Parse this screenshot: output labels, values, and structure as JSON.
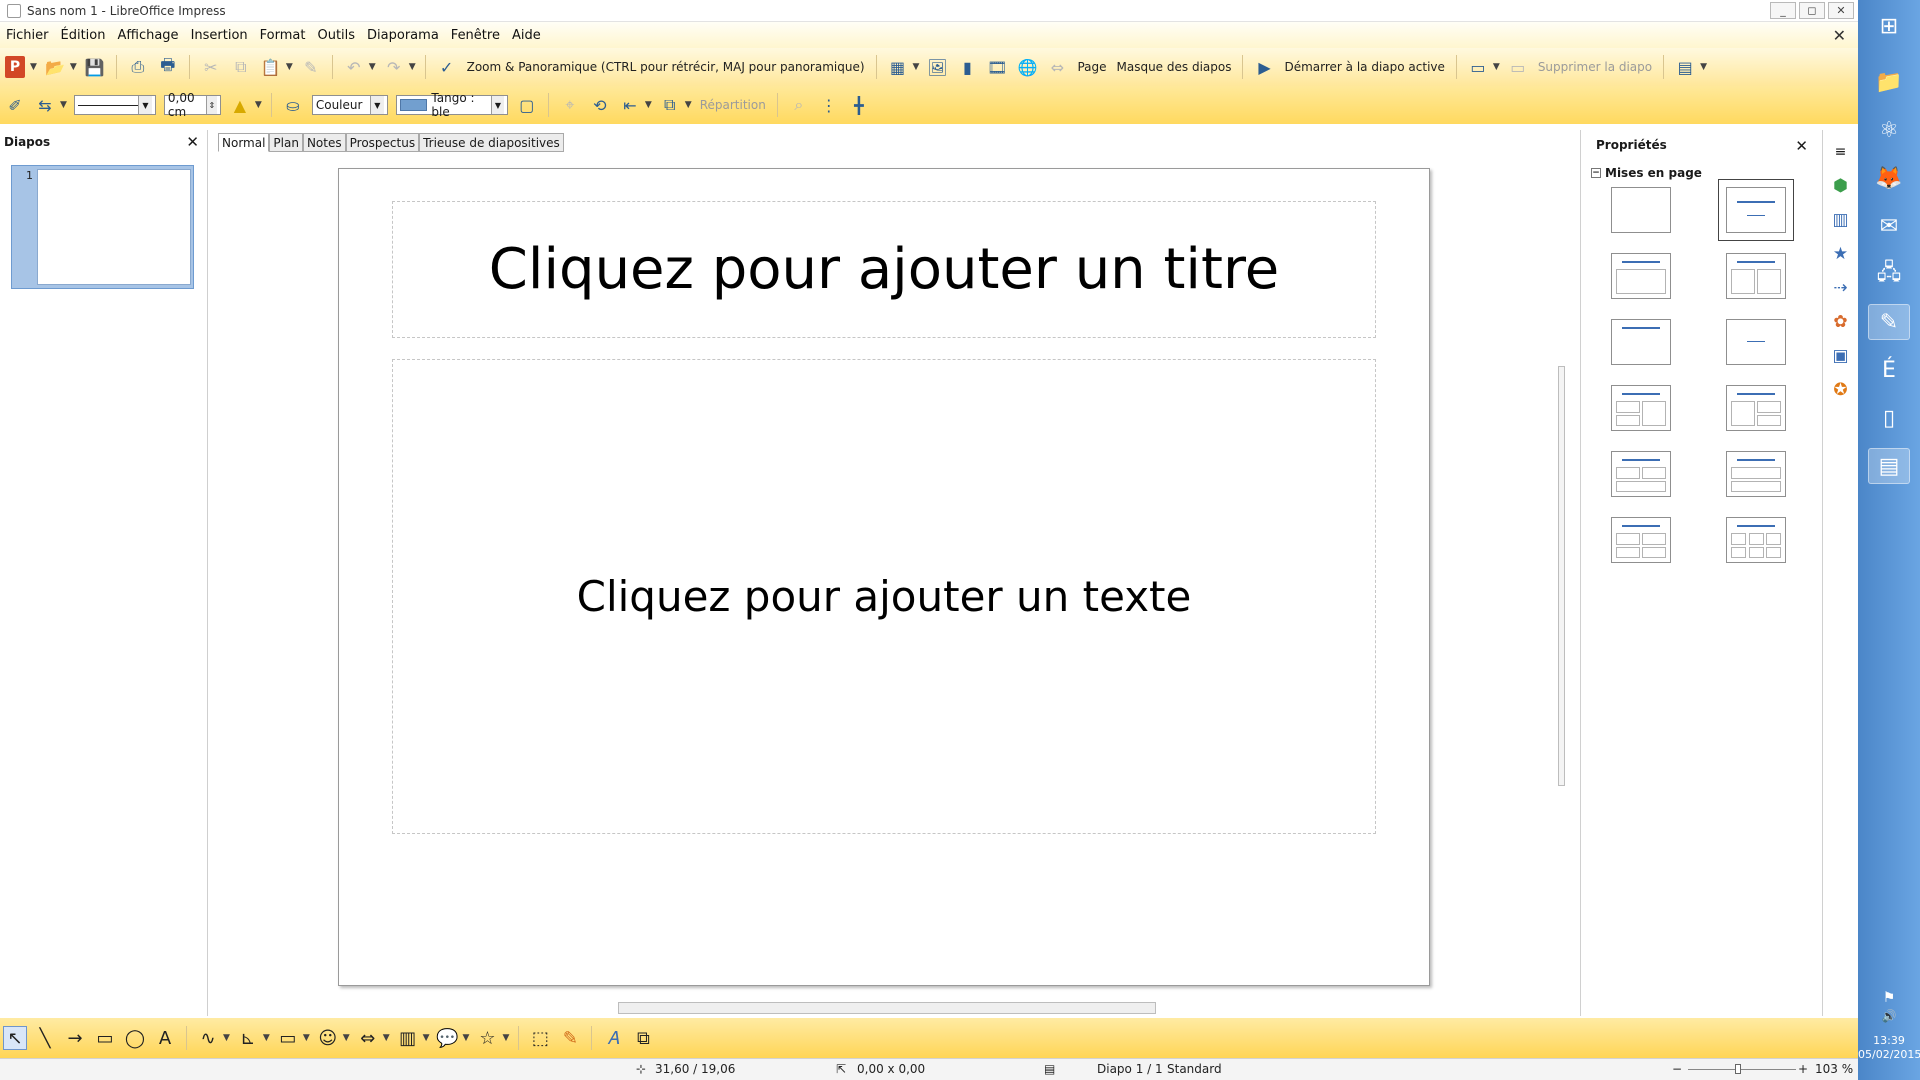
{
  "window": {
    "title": "Sans nom 1 - LibreOffice Impress",
    "controls": [
      "_",
      "◻",
      "✕"
    ]
  },
  "menu": [
    "Fichier",
    "Édition",
    "Affichage",
    "Insertion",
    "Format",
    "Outils",
    "Diaporama",
    "Fenêtre",
    "Aide"
  ],
  "menu_close": "✕",
  "toolbar1": {
    "powerpoint_icon": "P",
    "zoom_label": "Zoom & Panoramique (CTRL pour rétrécir, MAJ pour panoramique)",
    "page_label": "Page",
    "master_label": "Masque des diapos",
    "start_label": "Démarrer à la diapo active",
    "delete_label": "Supprimer la diapo"
  },
  "toolbar2": {
    "line_width": "0,00 cm",
    "area_style": "Couleur",
    "color_name": "Tango : ble",
    "distribution_label": "Répartition"
  },
  "slides_pane": {
    "title": "Diapos",
    "close": "✕",
    "slide_number": "1"
  },
  "view_tabs": [
    "Normal",
    "Plan",
    "Notes",
    "Prospectus",
    "Trieuse de diapositives"
  ],
  "slide": {
    "title_placeholder": "Cliquez pour ajouter un titre",
    "body_placeholder": "Cliquez pour ajouter un texte"
  },
  "properties": {
    "title": "Propriétés",
    "close": "✕",
    "section": "Mises en page",
    "collapse_symbol": "−"
  },
  "status": {
    "position": "31,60 / 19,06",
    "size": "0,00 x 0,00",
    "slide_info": "Diapo 1 / 1",
    "master": "Standard",
    "zoom": "103 %"
  },
  "taskbar": {
    "time": "13:39",
    "date": "05/02/2015"
  },
  "colors": {
    "accent_yellow": "#ffd95f",
    "selection_blue": "#a7c4e6",
    "layout_title_blue": "#3c6eb4"
  }
}
